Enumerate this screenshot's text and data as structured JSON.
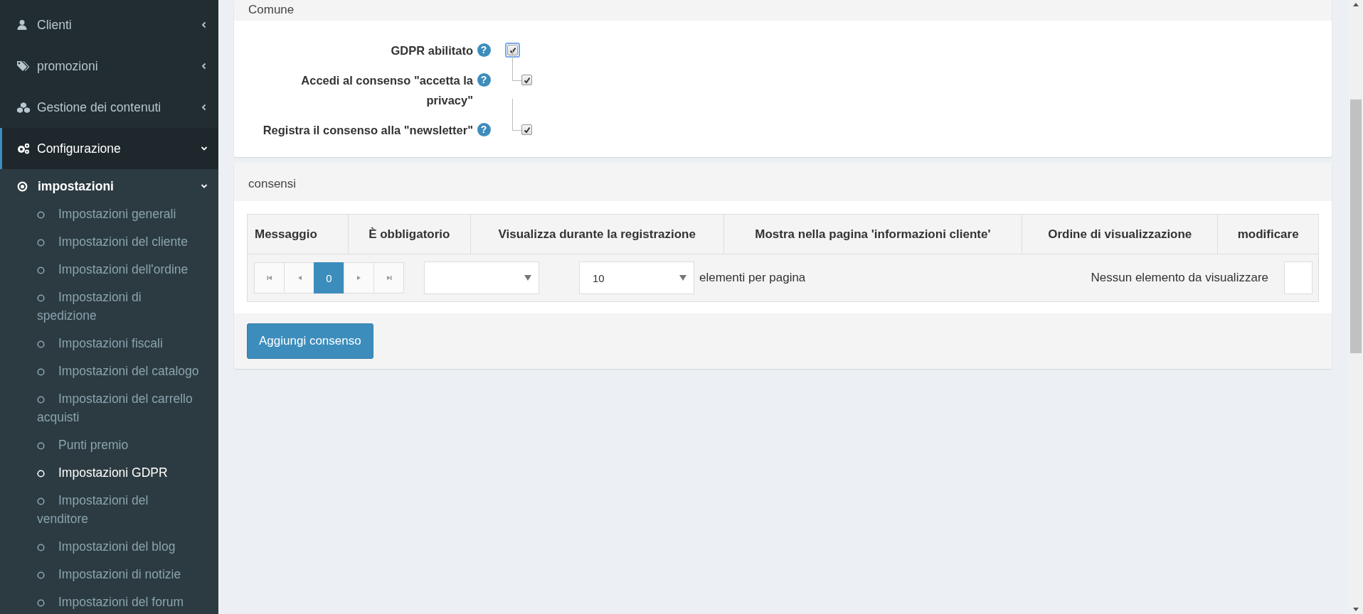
{
  "sidebar": {
    "items": [
      {
        "label": "Clienti",
        "expanded": false,
        "selected": false
      },
      {
        "label": "promozioni",
        "expanded": false,
        "selected": false
      },
      {
        "label": "Gestione dei contenuti",
        "expanded": false,
        "selected": false
      },
      {
        "label": "Configurazione",
        "expanded": true,
        "selected": true,
        "children": [
          {
            "label": "impostazioni",
            "expanded": true,
            "children": [
              {
                "label": "Impostazioni generali",
                "selected": false
              },
              {
                "label": "Impostazioni del cliente",
                "selected": false
              },
              {
                "label": "Impostazioni dell'ordine",
                "selected": false
              },
              {
                "label": "Impostazioni di spedizione",
                "selected": false
              },
              {
                "label": "Impostazioni fiscali",
                "selected": false
              },
              {
                "label": "Impostazioni del catalogo",
                "selected": false
              },
              {
                "label": "Impostazioni del carrello acquisti",
                "selected": false
              },
              {
                "label": "Punti premio",
                "selected": false
              },
              {
                "label": "Impostazioni GDPR",
                "selected": true
              },
              {
                "label": "Impostazioni del venditore",
                "selected": false
              },
              {
                "label": "Impostazioni del blog",
                "selected": false
              },
              {
                "label": "Impostazioni di notizie",
                "selected": false
              },
              {
                "label": "Impostazioni del forum",
                "selected": false
              }
            ]
          }
        ]
      }
    ]
  },
  "common_card": {
    "title": "Comune",
    "settings": [
      {
        "label": "GDPR abilitato",
        "help": "?",
        "checked": true,
        "focused": true,
        "children": [
          {
            "label": "Accedi al consenso \"accetta la privacy\"",
            "help": "?",
            "checked": true,
            "focused": false
          },
          {
            "label": "Registra il consenso alla \"newsletter\"",
            "help": "?",
            "checked": true,
            "focused": false
          }
        ]
      }
    ]
  },
  "consents_card": {
    "title": "consensi",
    "table": {
      "columns": [
        "Messaggio",
        "È obbligatorio",
        "Visualizza durante la registrazione",
        "Mostra nella pagina 'informazioni cliente'",
        "Ordine di visualizzazione",
        "modificare"
      ],
      "pager": {
        "pages": [
          {
            "label": "0",
            "selected": true
          }
        ],
        "page_size": "10",
        "page_size_label": "elementi per pagina",
        "empty_message": "Nessun elemento da visualizzare"
      }
    },
    "add_button": "Aggiungi consenso"
  }
}
